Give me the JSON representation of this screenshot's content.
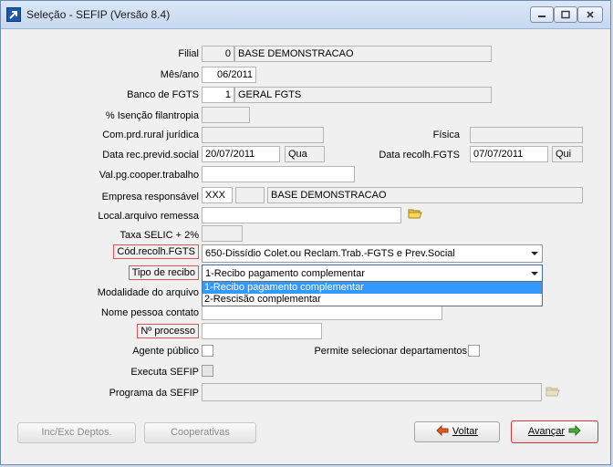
{
  "window": {
    "title": "Seleção - SEFIP (Versão 8.4)",
    "icon": "app-arrow-icon",
    "controls": [
      "minimize-icon",
      "maximize-icon",
      "close-icon"
    ]
  },
  "form": {
    "filial": {
      "label": "Filial",
      "code": "0",
      "name": "BASE DEMONSTRACAO"
    },
    "mes_ano": {
      "label": "Mês/ano",
      "value": "06/2011"
    },
    "banco_fgts": {
      "label": "Banco de FGTS",
      "code": "1",
      "name": "GERAL FGTS"
    },
    "isencao": {
      "label": "% Isenção filantropia",
      "value": ""
    },
    "com_prd_juridica": {
      "label": "Com.prd.rural jurídica",
      "value": ""
    },
    "fisica": {
      "label": "Física",
      "value": ""
    },
    "data_rec_previd": {
      "label": "Data rec.previd.social",
      "value": "20/07/2011",
      "weekday": "Qua"
    },
    "data_recolh_fgts": {
      "label": "Data recolh.FGTS",
      "value": "07/07/2011",
      "weekday": "Qui"
    },
    "val_pg_cooper": {
      "label": "Val.pg.cooper.trabalho",
      "value": ""
    },
    "empresa_responsavel": {
      "label": "Empresa responsável",
      "code": "XXX",
      "code2": "",
      "name": "BASE DEMONSTRACAO"
    },
    "local_arquivo": {
      "label": "Local.arquivo remessa",
      "value": ""
    },
    "taxa_selic": {
      "label": "Taxa SELIC + 2%",
      "value": ""
    },
    "cod_recolh": {
      "label": "Cód.recolh.FGTS",
      "value": "650-Dissídio Colet.ou Reclam.Trab.-FGTS e Prev.Social"
    },
    "tipo_recibo": {
      "label": "Tipo de recibo",
      "value": "1-Recibo pagamento complementar",
      "options": [
        "1-Recibo pagamento complementar",
        "2-Rescisão complementar"
      ]
    },
    "modalidade": {
      "label": "Modalidade do arquivo"
    },
    "nome_contato": {
      "label": "Nome pessoa contato",
      "value": ""
    },
    "num_processo": {
      "label": "Nº processo",
      "value": ""
    },
    "agente_publico": {
      "label": "Agente público",
      "checked": false
    },
    "permite_departamentos": {
      "label": "Permite selecionar departamentos",
      "checked": false
    },
    "executa_sefip": {
      "label": "Executa SEFIP",
      "checked": false
    },
    "programa_sefip": {
      "label": "Programa da SEFIP",
      "value": ""
    }
  },
  "buttons": {
    "inc_exc": "Inc/Exc Deptos.",
    "cooperativas": "Cooperativas",
    "voltar": "Voltar",
    "avancar": "Avançar"
  },
  "colors": {
    "highlight_border": "#e25454",
    "selection": "#3399ff",
    "titlebar": "#c7d8ef"
  }
}
